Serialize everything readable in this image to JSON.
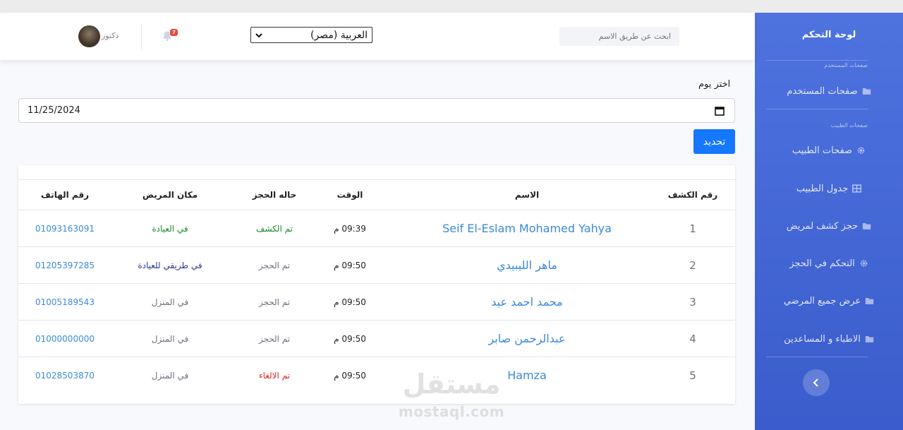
{
  "sidebar": {
    "brand": "لوحة التحكم",
    "section_user": "صفحات المستخدم",
    "section_doctor": "صفحات الطبيب",
    "items": [
      {
        "label": "صفحات المستخدم",
        "icon": "folder-icon"
      },
      {
        "label": "صفحات الطبيب",
        "icon": "gear-icon"
      },
      {
        "label": "جدول الطبيب",
        "icon": "table-icon"
      },
      {
        "label": "حجز كشف لمريض",
        "icon": "folder-icon"
      },
      {
        "label": "التحكم في الحجز",
        "icon": "gear-icon"
      },
      {
        "label": "عرض جميع المرضي",
        "icon": "folder-icon"
      },
      {
        "label": "الاطباء و المساعدين",
        "icon": "folder-icon"
      }
    ],
    "toggle_icon": "chevron-left-icon"
  },
  "topbar": {
    "search_placeholder": "ابحث عن طريق الاسم",
    "language_selected": "العربية (مصر)",
    "notification_count": "7",
    "user_name": "دكتور"
  },
  "content": {
    "day_label": "اختر يوم",
    "date_value": "11/25/2024",
    "update_button": "تحديد"
  },
  "table": {
    "headers": {
      "number": "رقم الكشف",
      "name": "الاسم",
      "time": "الوقت",
      "status": "حاله الحجز",
      "location": "مكان المريض",
      "phone": "رقم الهاتف"
    },
    "rows": [
      {
        "number": "1",
        "name": "Seif El-Eslam Mohamed Yahya",
        "time": "09:39 م",
        "status": "تم الكشف",
        "location": "في العيادة",
        "phone": "01093163091"
      },
      {
        "number": "2",
        "name": "ماهر الليبيدي",
        "time": "09:50 م",
        "status": "تم الحجز",
        "location": "في طريقي للعيادة",
        "phone": "01205397285"
      },
      {
        "number": "3",
        "name": "محمد احمد عيد",
        "time": "09:50 م",
        "status": "تم الحجز",
        "location": "في المنزل",
        "phone": "01005189543"
      },
      {
        "number": "4",
        "name": "عبدالرحمن صابر",
        "time": "09:50 م",
        "status": "تم الحجز",
        "location": "في المنزل",
        "phone": "01000000000"
      },
      {
        "number": "5",
        "name": "Hamza",
        "time": "09:50 م",
        "status": "تم الالغاء",
        "location": "في المنزل",
        "phone": "01028503870"
      }
    ]
  },
  "colors": {
    "sidebar": "#4e73df",
    "primary_button": "#1677ff",
    "link": "#3b8ad8",
    "status_done": "#1a8a2a",
    "status_booked": "#6e707e",
    "status_cancelled": "#e02424",
    "location_clinic": "#1a8a2a",
    "location_on_way": "#2c3a8c",
    "location_home": "#6e707e"
  },
  "watermark": {
    "arabic": "مستقل",
    "latin": "mostaql.com"
  }
}
